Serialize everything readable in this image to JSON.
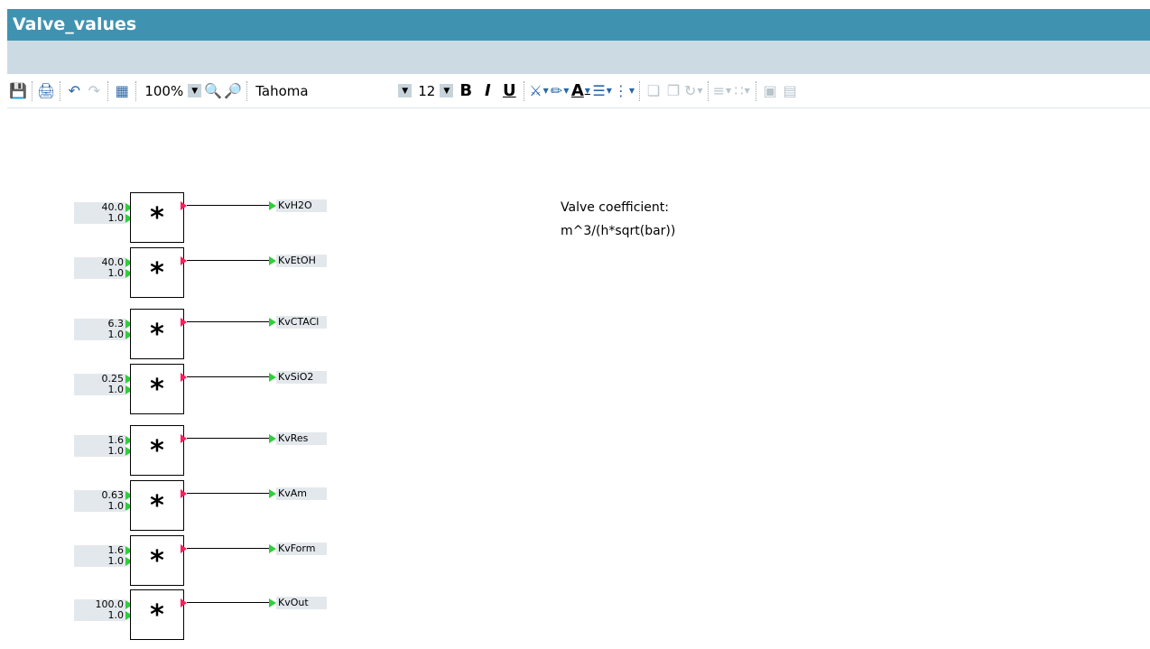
{
  "window": {
    "title": "Valve_values"
  },
  "toolbar": {
    "zoom": "100%",
    "font_name": "Tahoma",
    "font_size": "12",
    "bold_label": "B",
    "italic_label": "I",
    "underline_label": "U",
    "text_color_label": "A"
  },
  "note": {
    "line1": "Valve coefficient:",
    "line2": "m^3/(h*sqrt(bar))"
  },
  "blocks": [
    {
      "in1": "40.0",
      "in2": "1.0",
      "op": "*",
      "out": "KvH2O"
    },
    {
      "in1": "40.0",
      "in2": "1.0",
      "op": "*",
      "out": "KvEtOH"
    },
    {
      "in1": "6.3",
      "in2": "1.0",
      "op": "*",
      "out": "KvCTACl"
    },
    {
      "in1": "0.25",
      "in2": "1.0",
      "op": "*",
      "out": "KvSiO2"
    },
    {
      "in1": "1.6",
      "in2": "1.0",
      "op": "*",
      "out": "KvRes"
    },
    {
      "in1": "0.63",
      "in2": "1.0",
      "op": "*",
      "out": "KvAm"
    },
    {
      "in1": "1.6",
      "in2": "1.0",
      "op": "*",
      "out": "KvForm"
    },
    {
      "in1": "100.0",
      "in2": "1.0",
      "op": "*",
      "out": "KvOut"
    }
  ]
}
